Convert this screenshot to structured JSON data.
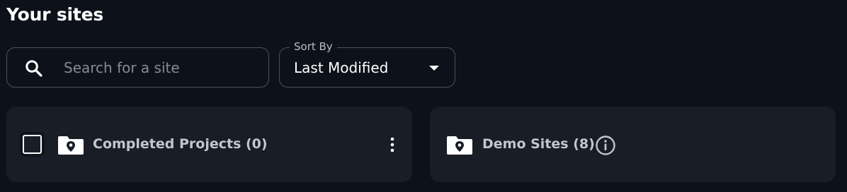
{
  "page": {
    "title": "Your sites"
  },
  "search": {
    "placeholder": "Search for a site",
    "value": "",
    "icon": "search-icon"
  },
  "sort": {
    "label": "Sort By",
    "selected": "Last Modified",
    "icon": "caret-down-icon"
  },
  "folders": [
    {
      "title": "Completed Projects (0)",
      "icon": "folder-location-icon",
      "has_checkbox": true,
      "checked": false,
      "menu_icon": "kebab-menu-icon"
    },
    {
      "title": "Demo Sites (8)",
      "icon": "folder-location-icon",
      "info_icon": "info-icon"
    }
  ],
  "colors": {
    "background": "#0d121a",
    "card": "#181d26",
    "border": "#4a5160",
    "text": "#ffffff",
    "muted_text": "#c3c7cd"
  }
}
